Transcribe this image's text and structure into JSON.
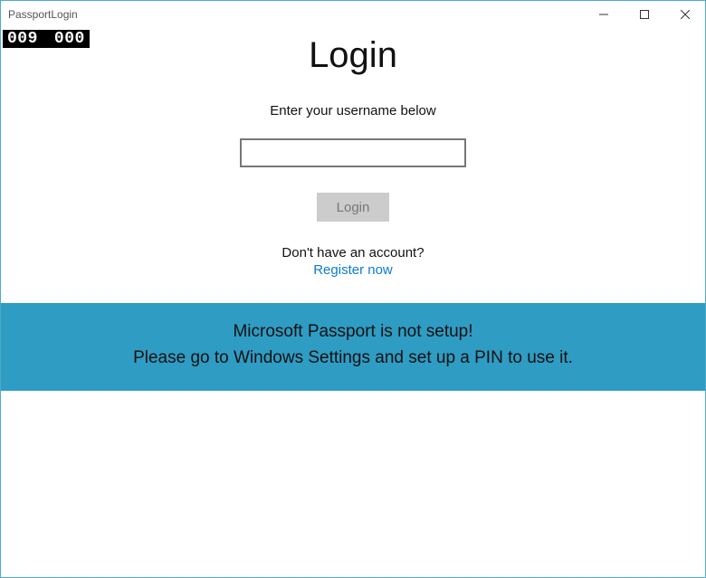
{
  "window": {
    "title": "PassportLogin"
  },
  "counters": {
    "left": "009",
    "right": "000"
  },
  "main": {
    "title": "Login",
    "prompt": "Enter your username below",
    "username_value": "",
    "login_button": "Login",
    "no_account": "Don't have an account?",
    "register_link": "Register now"
  },
  "banner": {
    "line1": "Microsoft Passport is not setup!",
    "line2": "Please go to Windows Settings and set up a PIN to use it."
  }
}
